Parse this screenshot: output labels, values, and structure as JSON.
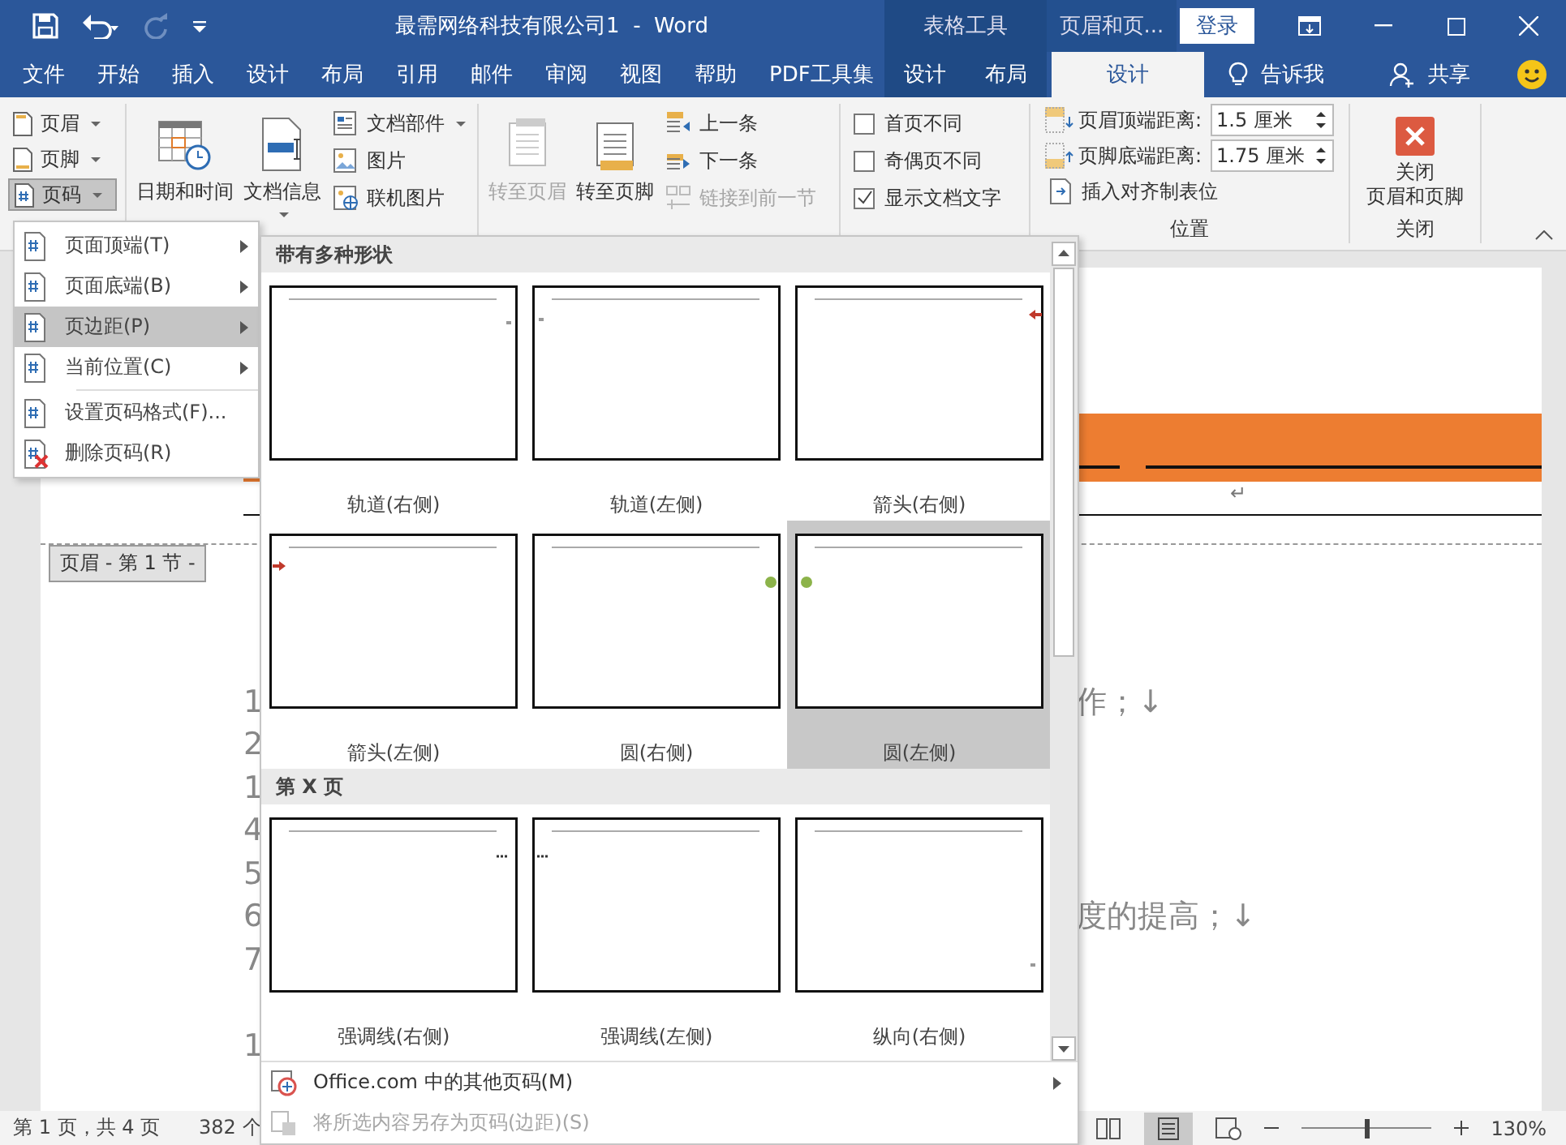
{
  "title_bar": {
    "title": "最需网络科技有限公司1  -  Word",
    "contextual_groups": [
      {
        "label": "表格工具",
        "kind": "table"
      },
      {
        "label": "页眉和页...",
        "kind": "header"
      }
    ],
    "login": "登录"
  },
  "tabs": [
    {
      "label": "文件",
      "selected": false
    },
    {
      "label": "开始",
      "selected": false
    },
    {
      "label": "插入",
      "selected": false
    },
    {
      "label": "设计",
      "selected": false
    },
    {
      "label": "布局",
      "selected": false
    },
    {
      "label": "引用",
      "selected": false
    },
    {
      "label": "邮件",
      "selected": false
    },
    {
      "label": "审阅",
      "selected": false
    },
    {
      "label": "视图",
      "selected": false
    },
    {
      "label": "帮助",
      "selected": false
    },
    {
      "label": "PDF工具集",
      "selected": false
    }
  ],
  "table_tools_tabs": [
    {
      "label": "设计",
      "selected": false
    },
    {
      "label": "布局",
      "selected": false
    }
  ],
  "header_tools_tabs": [
    {
      "label": "设计",
      "selected": true
    }
  ],
  "tell_me": "告诉我",
  "share": "共享",
  "ribbon": {
    "header_footer": [
      {
        "label": "页眉",
        "selected": false
      },
      {
        "label": "页脚",
        "selected": false
      },
      {
        "label": "页码",
        "selected": true
      }
    ],
    "insert_big": [
      {
        "label": "日期和时间",
        "dropdown": false
      },
      {
        "label": "文档信息",
        "dropdown": true
      }
    ],
    "insert_small": [
      {
        "label": "文档部件",
        "dropdown": true
      },
      {
        "label": "图片",
        "dropdown": false
      },
      {
        "label": "联机图片",
        "dropdown": false
      }
    ],
    "nav_big": [
      {
        "label": "转至页眉",
        "disabled": true
      },
      {
        "label": "转至页脚",
        "disabled": false
      }
    ],
    "nav_small": [
      {
        "label": "上一条",
        "disabled": false
      },
      {
        "label": "下一条",
        "disabled": false
      },
      {
        "label": "链接到前一节",
        "disabled": true
      }
    ],
    "options": [
      {
        "label": "首页不同",
        "checked": false
      },
      {
        "label": "奇偶页不同",
        "checked": false
      },
      {
        "label": "显示文档文字",
        "checked": true
      }
    ],
    "position": {
      "fields": [
        {
          "label": "页眉顶端距离:",
          "value": "1.5 厘米"
        },
        {
          "label": "页脚底端距离:",
          "value": "1.75 厘米"
        }
      ],
      "tab_stop": "插入对齐制表位",
      "group_label": "位置"
    },
    "close": {
      "lines": [
        "关闭",
        "页眉和页脚"
      ],
      "group_label": "关闭"
    }
  },
  "page_number_menu": {
    "sections": [
      {
        "items": [
          {
            "label": "页面顶端(T)",
            "submenu": true,
            "selected": false
          },
          {
            "label": "页面底端(B)",
            "submenu": true,
            "selected": false
          },
          {
            "label": "页边距(P)",
            "submenu": true,
            "selected": true
          },
          {
            "label": "当前位置(C)",
            "submenu": true,
            "selected": false
          }
        ]
      },
      {
        "items": [
          {
            "label": "设置页码格式(F)...",
            "submenu": false,
            "selected": false
          },
          {
            "label": "删除页码(R)",
            "submenu": false,
            "selected": false
          }
        ]
      }
    ]
  },
  "gallery": {
    "sections": [
      {
        "title": "带有多种形状",
        "items": [
          {
            "label": "轨道(右侧)",
            "kind": "track-right",
            "selected": false
          },
          {
            "label": "轨道(左侧)",
            "kind": "track-left",
            "selected": false
          },
          {
            "label": "箭头(右侧)",
            "kind": "arrow-right",
            "selected": false
          },
          {
            "label": "箭头(左侧)",
            "kind": "arrow-left",
            "selected": false
          },
          {
            "label": "圆(右侧)",
            "kind": "circle-right",
            "selected": false
          },
          {
            "label": "圆(左侧)",
            "kind": "circle-left",
            "selected": true
          }
        ]
      },
      {
        "title": "第 X 页",
        "items": [
          {
            "label": "强调线(右侧)",
            "kind": "accent-right",
            "selected": false
          },
          {
            "label": "强调线(左侧)",
            "kind": "accent-left",
            "selected": false
          },
          {
            "label": "纵向(右侧)",
            "kind": "vertical-right",
            "selected": false
          }
        ]
      }
    ],
    "footer": [
      {
        "label": "Office.com 中的其他页码(M)",
        "disabled": false,
        "submenu": true
      },
      {
        "label": "将所选内容另存为页码(边距)(S)",
        "disabled": true,
        "submenu": false
      }
    ]
  },
  "document": {
    "return_mark": "↵",
    "section_tag": "页眉 - 第 1 节 -",
    "left_column": [
      "1",
      "2",
      "1",
      "4",
      "5",
      "6",
      "7"
    ],
    "left_tail": "1",
    "right_fragments": [
      "作；↓",
      "度的提高；↓"
    ]
  },
  "status_bar": {
    "page": "第 1 页，共 4 页",
    "words": "382 个",
    "zoom": {
      "level": 0.5
    },
    "zoom_text": "130%"
  }
}
